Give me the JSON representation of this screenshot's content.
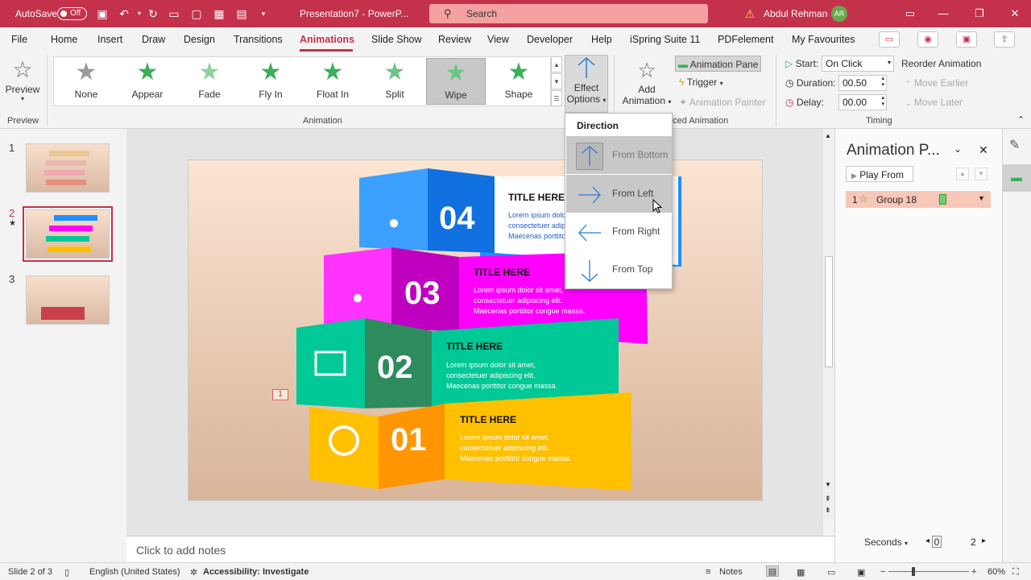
{
  "titlebar": {
    "autosave": "AutoSave",
    "autosave_state": "Off",
    "doc_title": "Presentation7 - PowerP...",
    "search_placeholder": "Search",
    "user_name": "Abdul Rehman",
    "user_initials": "AR"
  },
  "menu": {
    "items": [
      "File",
      "Home",
      "Insert",
      "Draw",
      "Design",
      "Transitions",
      "Animations",
      "Slide Show",
      "Review",
      "View",
      "Developer",
      "Help",
      "iSpring Suite 11",
      "PDFelement",
      "My Favourites"
    ],
    "active": "Animations"
  },
  "ribbon": {
    "preview_label": "Preview",
    "preview_group": "Preview",
    "animation_group": "Animation",
    "advanced_group": "nced Animation",
    "timing_group": "Timing",
    "animations": [
      "None",
      "Appear",
      "Fade",
      "Fly In",
      "Float In",
      "Split",
      "Wipe",
      "Shape"
    ],
    "selected_animation": "Wipe",
    "effect_options": [
      "Effect",
      "Options"
    ],
    "add_animation": [
      "Add",
      "Animation"
    ],
    "animation_pane": "Animation Pane",
    "trigger": "Trigger",
    "animation_painter": "Animation Painter",
    "start_label": "Start:",
    "start_value": "On Click",
    "duration_label": "Duration:",
    "duration_value": "00.50",
    "delay_label": "Delay:",
    "delay_value": "00.00",
    "reorder": "Reorder Animation",
    "move_earlier": "Move Earlier",
    "move_later": "Move Later"
  },
  "dropdown": {
    "header": "Direction",
    "items": [
      "From Bottom",
      "From Left",
      "From Right",
      "From Top"
    ]
  },
  "thumbnails": [
    "1",
    "2",
    "3"
  ],
  "slide": {
    "anim_marker": "1",
    "steps": [
      {
        "num": "04",
        "title": "TITLE HERE",
        "text": [
          "Lorem ipsum dolor sit amet,",
          "consectetuer adipiscing elit.",
          "Maecenas porttitor congue massa."
        ]
      },
      {
        "num": "03",
        "title": "TITLE HERE",
        "text": [
          "Lorem ipsum dolor sit amet,",
          "consectetuer adipiscing elit.",
          "Maecenas porttitor congue massa."
        ]
      },
      {
        "num": "02",
        "title": "TITLE HERE",
        "text": [
          "Lorem ipsum dolor sit amet,",
          "consectetuer adipiscing elit.",
          "Maecenas porttitor congue massa."
        ]
      },
      {
        "num": "01",
        "title": "TITLE HERE",
        "text": [
          "Lorem ipsum dolor sit amet,",
          "consectetuer adipiscing elit.",
          "Maecenas porttitor congue massa."
        ]
      }
    ]
  },
  "notes_placeholder": "Click to add notes",
  "animpane": {
    "title": "Animation P...",
    "play_from": "Play From",
    "item_index": "1",
    "item_name": "Group 18",
    "seconds": "Seconds",
    "timeline_start": "0",
    "timeline_end": "2"
  },
  "statusbar": {
    "slide_info": "Slide 2 of 3",
    "language": "English (United States)",
    "accessibility": "Accessibility: Investigate",
    "notes": "Notes",
    "zoom": "60%"
  },
  "colors": {
    "accent": "#c4314b",
    "step4": "#1e90ff",
    "step3": "#ff00ff",
    "step2": "#00c896",
    "step1": "#ffc000"
  }
}
